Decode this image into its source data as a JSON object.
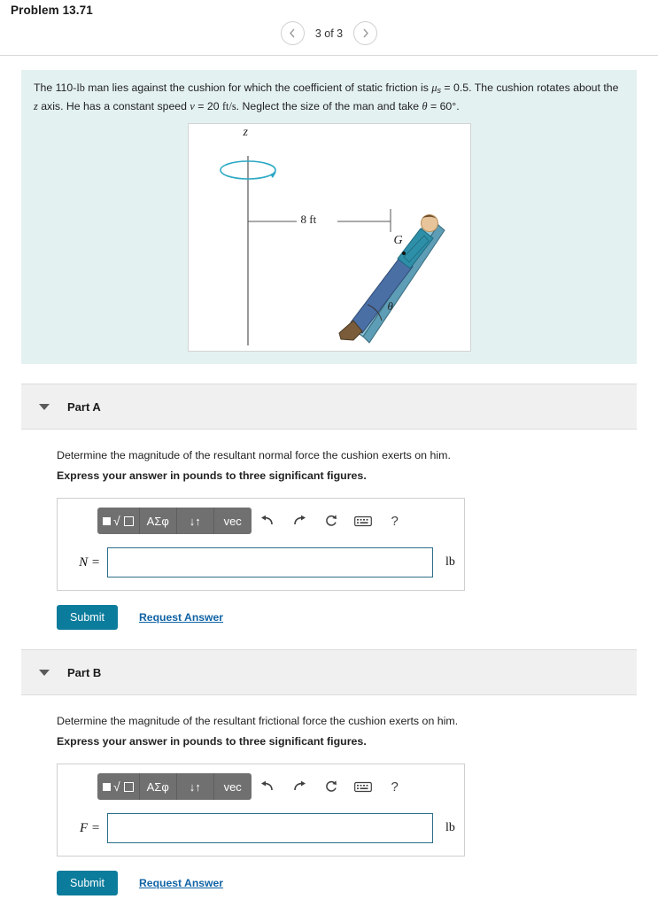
{
  "header": {
    "problem_title": "Problem 13.71",
    "pager_label": "3 of 3",
    "prev_icon": "chevron-left-icon",
    "next_icon": "chevron-right-icon"
  },
  "statement": {
    "line1_a": "The 110-",
    "line1_lb": "lb",
    "line1_b": " man lies against the cushion for which the coefficient of static friction is ",
    "mu": "μ",
    "mu_sub": "s",
    "line1_c": " = 0.5. The cushion rotates",
    "line2_a": "about the ",
    "z": "z",
    "line2_b": " axis. He has a constant speed ",
    "v": "v",
    "line2_c": " = 20 ",
    "units_ftps": "ft/s",
    "line2_d": ". Neglect the size of the man and take ",
    "theta": "θ",
    "line2_e": " = 60",
    "degree": "°",
    "line2_f": "."
  },
  "figure": {
    "axis_label_z": "z",
    "dimension_label": "8 ft",
    "point_label": "G",
    "angle_label": "θ"
  },
  "parts": [
    {
      "title": "Part A",
      "prompt": "Determine the magnitude of the resultant normal force the cushion exerts on him.",
      "instruction": "Express your answer in pounds to three significant figures.",
      "variable": "N =",
      "value": "",
      "placeholder": "",
      "unit": "lb",
      "submit_label": "Submit",
      "request_label": "Request Answer",
      "toolbar": {
        "template_label": "■√□",
        "greek_label": "ΑΣφ",
        "arrows_label": "↓↑",
        "vec_label": "vec",
        "undo_icon": "undo-arrow-icon",
        "redo_icon": "redo-arrow-icon",
        "reset_icon": "reset-circular-arrow-icon",
        "keyboard_icon": "keyboard-icon",
        "help_label": "?"
      }
    },
    {
      "title": "Part B",
      "prompt": "Determine the magnitude of the resultant frictional force the cushion exerts on him.",
      "instruction": "Express your answer in pounds to three significant figures.",
      "variable": "F =",
      "value": "",
      "placeholder": "",
      "unit": "lb",
      "submit_label": "Submit",
      "request_label": "Request Answer",
      "toolbar": {
        "template_label": "■√□",
        "greek_label": "ΑΣφ",
        "arrows_label": "↓↑",
        "vec_label": "vec",
        "undo_icon": "undo-arrow-icon",
        "redo_icon": "redo-arrow-icon",
        "reset_icon": "reset-circular-arrow-icon",
        "keyboard_icon": "keyboard-icon",
        "help_label": "?"
      }
    }
  ],
  "colors": {
    "statement_bg": "#e4f1f1",
    "accent": "#0c7c9c",
    "link": "#1063a5",
    "toolbar": "#707070",
    "figure_teal": "#2aa8c4"
  }
}
